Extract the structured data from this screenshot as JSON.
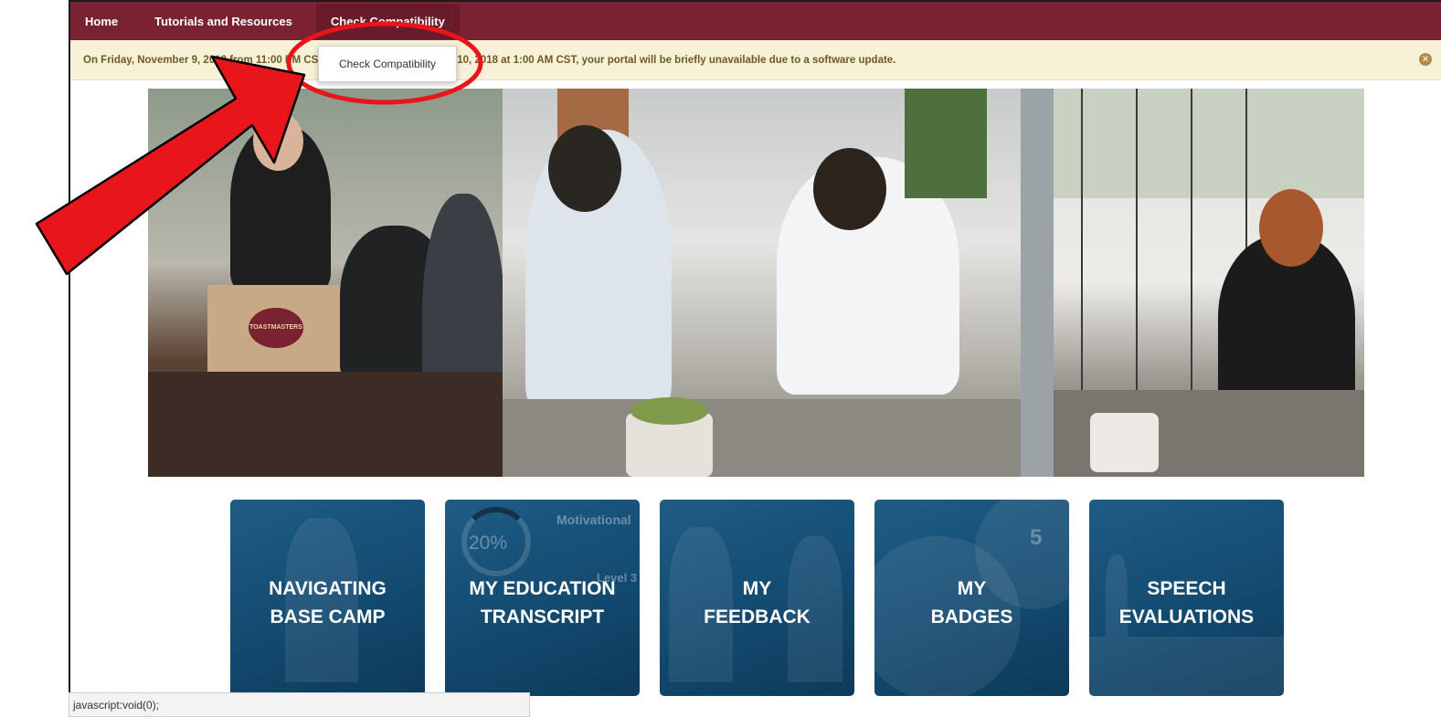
{
  "nav": {
    "items": [
      "Home",
      "Tutorials and Resources",
      "Check Compatibility"
    ]
  },
  "notice": {
    "text": "On Friday, November 9, 2018 from 11:00 PM CST until Saturday, November 10, 2018 at 1:00 AM CST, your portal will be briefly unavailable due to a software update.",
    "close_icon": "close-circle-icon"
  },
  "dropdown": {
    "item": "Check Compatibility"
  },
  "hero": {
    "podium_logo": "TOASTMASTERS"
  },
  "tiles": [
    {
      "label": "NAVIGATING\nBASE CAMP"
    },
    {
      "label": "MY EDUCATION\nTRANSCRIPT",
      "progress": "20%",
      "heading": "Motivational",
      "level": "Level 3"
    },
    {
      "label": "MY\nFEEDBACK"
    },
    {
      "label": "MY\nBADGES",
      "badge_number": "5"
    },
    {
      "label": "SPEECH\nEVALUATIONS"
    }
  ],
  "statusbar": {
    "text": "javascript:void(0);"
  },
  "colors": {
    "navbar": "#7b2232",
    "notice_bg": "#f7f1d7",
    "tile_blue": "#134a70",
    "annotation_red": "#e8151b"
  }
}
